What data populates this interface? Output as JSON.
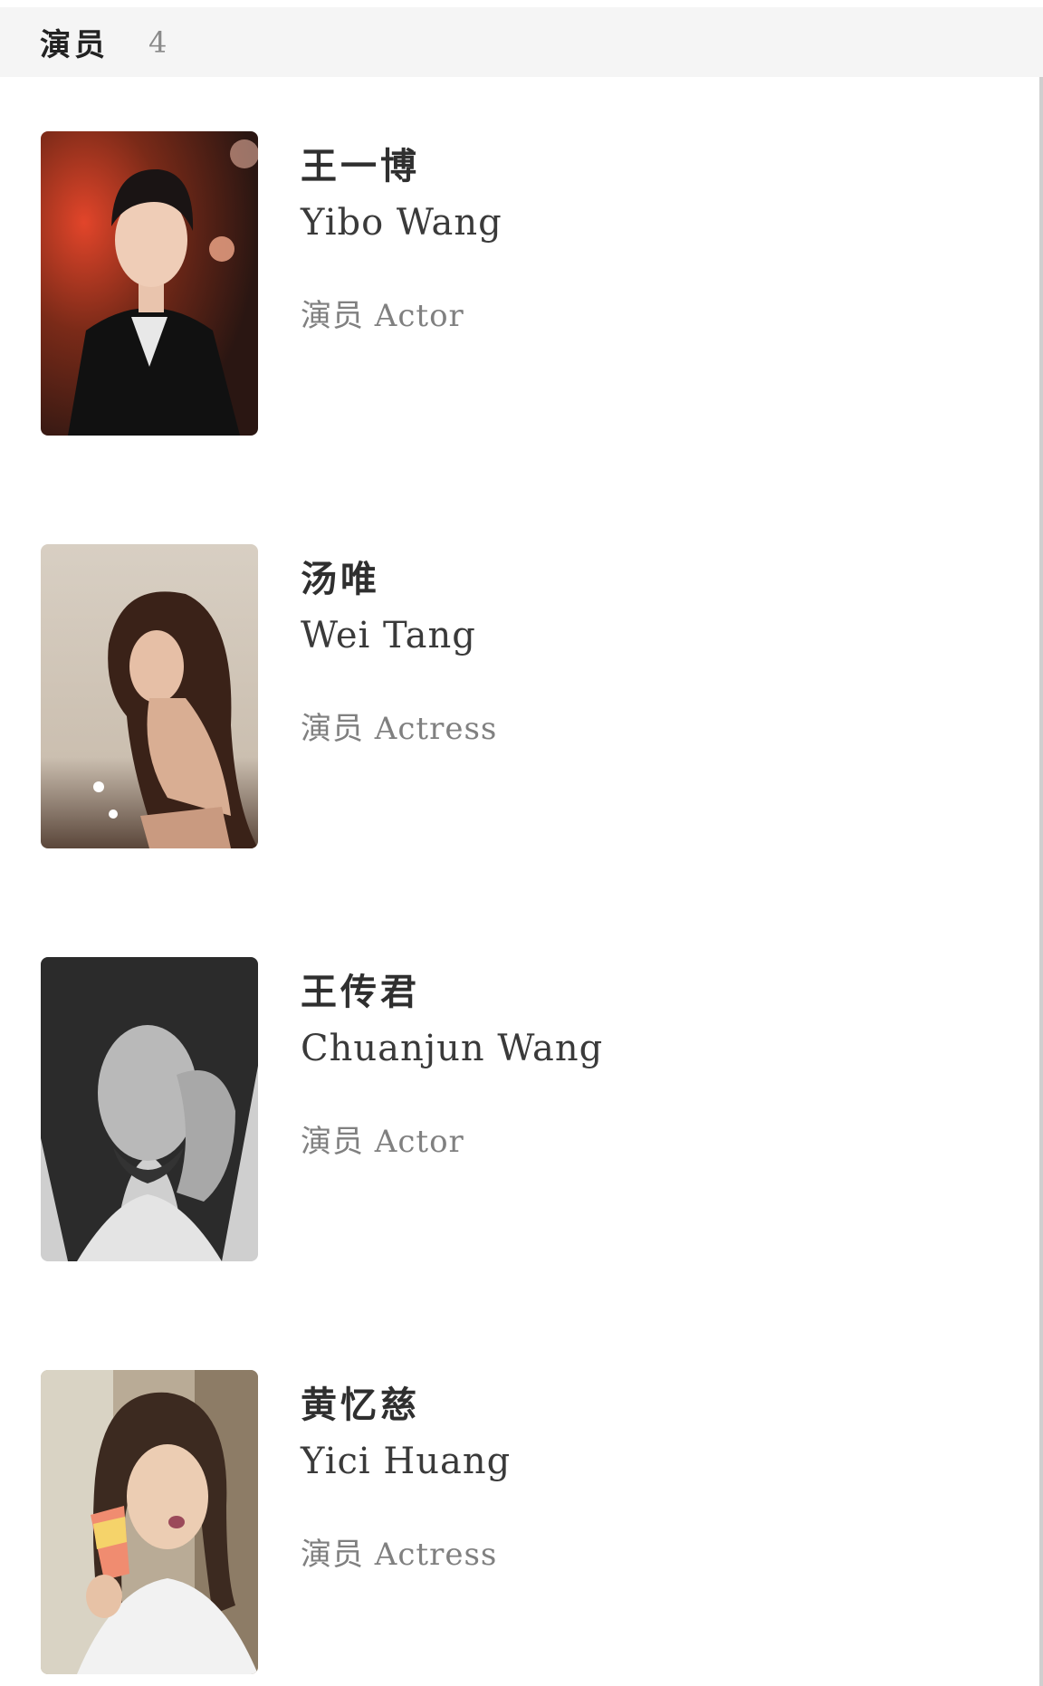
{
  "section": {
    "title": "演员",
    "count": "4"
  },
  "cast": [
    {
      "name_cn": "王一博",
      "name_en": "Yibo Wang",
      "role": "演员 Actor"
    },
    {
      "name_cn": "汤唯",
      "name_en": "Wei Tang",
      "role": "演员 Actress"
    },
    {
      "name_cn": "王传君",
      "name_en": "Chuanjun Wang",
      "role": "演员 Actor"
    },
    {
      "name_cn": "黄忆慈",
      "name_en": "Yici Huang",
      "role": "演员 Actress"
    }
  ]
}
